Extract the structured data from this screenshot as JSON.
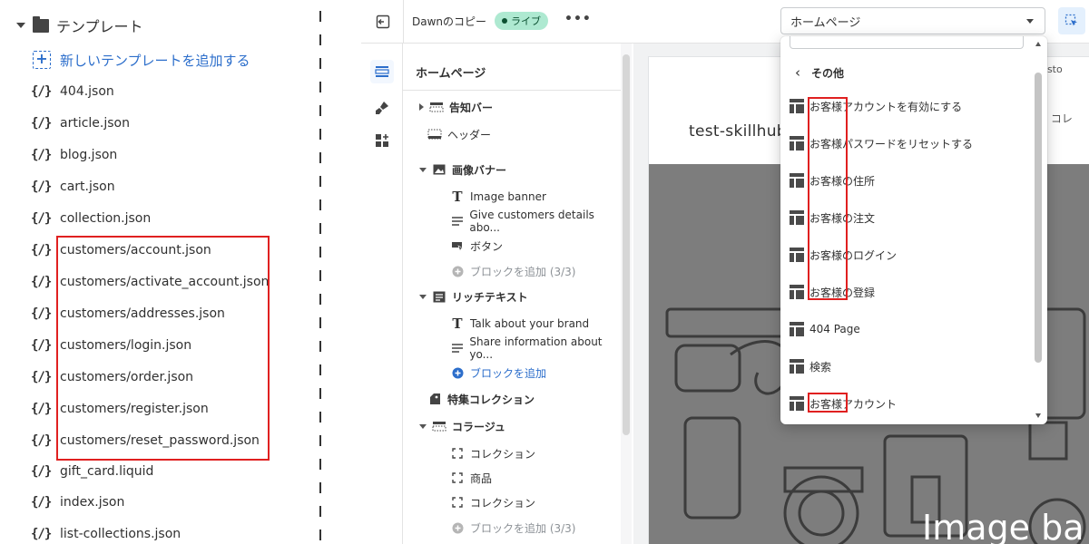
{
  "file_tree": {
    "folder_label": "テンプレート",
    "add_template_label": "新しいテンプレートを追加する",
    "files": [
      "404.json",
      "article.json",
      "blog.json",
      "cart.json",
      "collection.json",
      "customers/account.json",
      "customers/activate_account.json",
      "customers/addresses.json",
      "customers/login.json",
      "customers/order.json",
      "customers/register.json",
      "customers/reset_password.json",
      "gift_card.liquid",
      "index.json",
      "list-collections.json"
    ]
  },
  "topbar": {
    "theme_name": "Dawnのコピー",
    "live_badge": "ライブ",
    "more_label": "•••",
    "page_select_value": "ホームページ"
  },
  "panel": {
    "title": "ホームページ",
    "sections": [
      {
        "label": "告知バー"
      },
      {
        "label": "ヘッダー"
      },
      {
        "label": "画像バナー"
      },
      {
        "label": "Image banner"
      },
      {
        "label": "Give customers details abo..."
      },
      {
        "label": "ボタン"
      },
      {
        "label": "ブロックを追加 (3/3)"
      },
      {
        "label": "リッチテキスト"
      },
      {
        "label": "Talk about your brand"
      },
      {
        "label": "Share information about yo..."
      },
      {
        "label": "ブロックを追加"
      },
      {
        "label": "特集コレクション"
      },
      {
        "label": "コラージュ"
      },
      {
        "label": "コレクション"
      },
      {
        "label": "商品"
      },
      {
        "label": "コレクション"
      },
      {
        "label": "ブロックを追加 (3/3)"
      }
    ]
  },
  "preview": {
    "announcement": "o our sto",
    "store_name": "test-skillhub",
    "nav_text": "せ   コレ",
    "banner_heading": "Image ba"
  },
  "dropdown": {
    "back_label": "その他",
    "items": [
      "お客様アカウントを有効にする",
      "お客様パスワードをリセットする",
      "お客様の住所",
      "お客様の注文",
      "お客様のログイン",
      "お客様の登録",
      "404 Page",
      "検索",
      "お客様アカウント"
    ]
  },
  "colors": {
    "accent_blue": "#2c6ecb",
    "highlight_red": "#e02020",
    "live_badge_bg": "#aee9d1",
    "banner_gray": "#7d7d7d"
  },
  "icons": {
    "json_file": "{/}",
    "folder": "folder-icon",
    "add_template": "add-template-icon"
  }
}
